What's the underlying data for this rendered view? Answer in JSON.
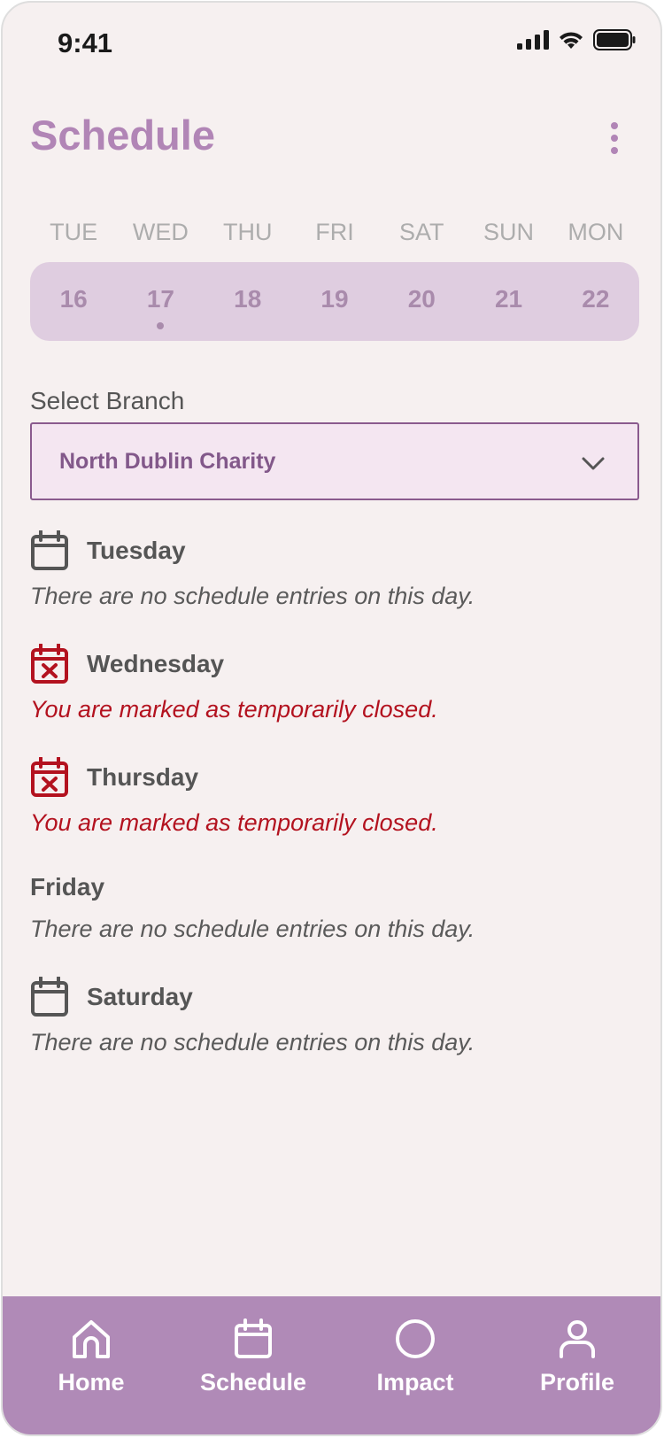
{
  "status_bar": {
    "time": "9:41"
  },
  "header": {
    "title": "Schedule"
  },
  "week": {
    "days": [
      "TUE",
      "WED",
      "THU",
      "FRI",
      "SAT",
      "SUN",
      "MON"
    ],
    "dates": [
      "16",
      "17",
      "18",
      "19",
      "20",
      "21",
      "22"
    ],
    "marked_date": "17"
  },
  "branch": {
    "label": "Select Branch",
    "selected": "North Dublin Charity"
  },
  "schedule": [
    {
      "day": "Tuesday",
      "note": "There are no schedule entries on this day.",
      "icon": "calendar-icon",
      "status": "empty"
    },
    {
      "day": "Wednesday",
      "note": "You are marked as temporarily closed.",
      "icon": "calendar-closed-icon",
      "status": "closed"
    },
    {
      "day": "Thursday",
      "note": "You are marked as temporarily closed.",
      "icon": "calendar-closed-icon",
      "status": "closed"
    },
    {
      "day": "Friday",
      "note": "There are no schedule entries on this day.",
      "icon": "",
      "status": "empty"
    },
    {
      "day": "Saturday",
      "note": "There are no schedule entries on this day.",
      "icon": "calendar-icon",
      "status": "empty"
    }
  ],
  "nav": {
    "items": [
      {
        "label": "Home",
        "icon": "home-icon"
      },
      {
        "label": "Schedule",
        "icon": "calendar-icon"
      },
      {
        "label": "Impact",
        "icon": "circle-icon"
      },
      {
        "label": "Profile",
        "icon": "user-icon"
      }
    ]
  },
  "colors": {
    "accent": "#b185b6",
    "closed": "#b3121f",
    "nav_bg": "#b08ab7"
  }
}
